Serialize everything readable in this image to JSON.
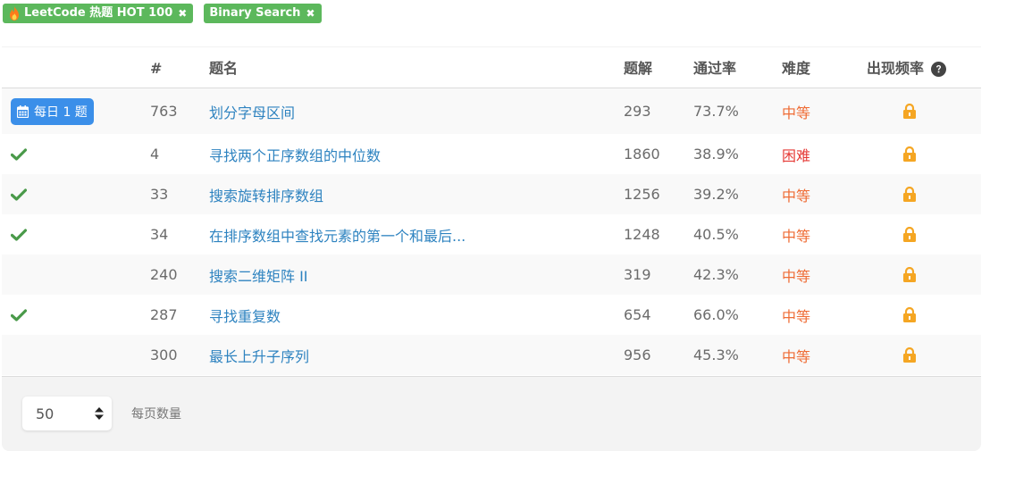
{
  "tags": [
    {
      "label": "LeetCode 热题 HOT 100",
      "icon": "flame-icon",
      "close_icon": "close-icon"
    },
    {
      "label": "Binary Search",
      "close_icon": "close-icon"
    }
  ],
  "table": {
    "headers": {
      "id": "#",
      "title": "题名",
      "solutions": "题解",
      "acceptance": "通过率",
      "difficulty": "难度",
      "frequency": "出现频率"
    },
    "rows": [
      {
        "status": "daily",
        "daily_label": "每日 1 题",
        "id": "763",
        "title": "划分字母区间",
        "solutions": "293",
        "acceptance": "73.7%",
        "difficulty": "中等"
      },
      {
        "status": "solved",
        "id": "4",
        "title": "寻找两个正序数组的中位数",
        "solutions": "1860",
        "acceptance": "38.9%",
        "difficulty": "困难"
      },
      {
        "status": "solved",
        "id": "33",
        "title": "搜索旋转排序数组",
        "solutions": "1256",
        "acceptance": "39.2%",
        "difficulty": "中等"
      },
      {
        "status": "solved",
        "id": "34",
        "title": "在排序数组中查找元素的第一个和最后...",
        "solutions": "1248",
        "acceptance": "40.5%",
        "difficulty": "中等"
      },
      {
        "status": "none",
        "id": "240",
        "title": "搜索二维矩阵 II",
        "solutions": "319",
        "acceptance": "42.3%",
        "difficulty": "中等"
      },
      {
        "status": "solved",
        "id": "287",
        "title": "寻找重复数",
        "solutions": "654",
        "acceptance": "66.0%",
        "difficulty": "中等"
      },
      {
        "status": "none",
        "id": "300",
        "title": "最长上升子序列",
        "solutions": "956",
        "acceptance": "45.3%",
        "difficulty": "中等"
      }
    ]
  },
  "pagination": {
    "page_size_value": "50",
    "page_size_label": "每页数量"
  },
  "colors": {
    "tag_bg": "#5cb85c",
    "daily_btn": "#3b8fe9",
    "link": "#2e83c0",
    "medium": "#ef6c35",
    "hard": "#e53935",
    "lock": "#f5a623",
    "check": "#4a9a4a"
  }
}
